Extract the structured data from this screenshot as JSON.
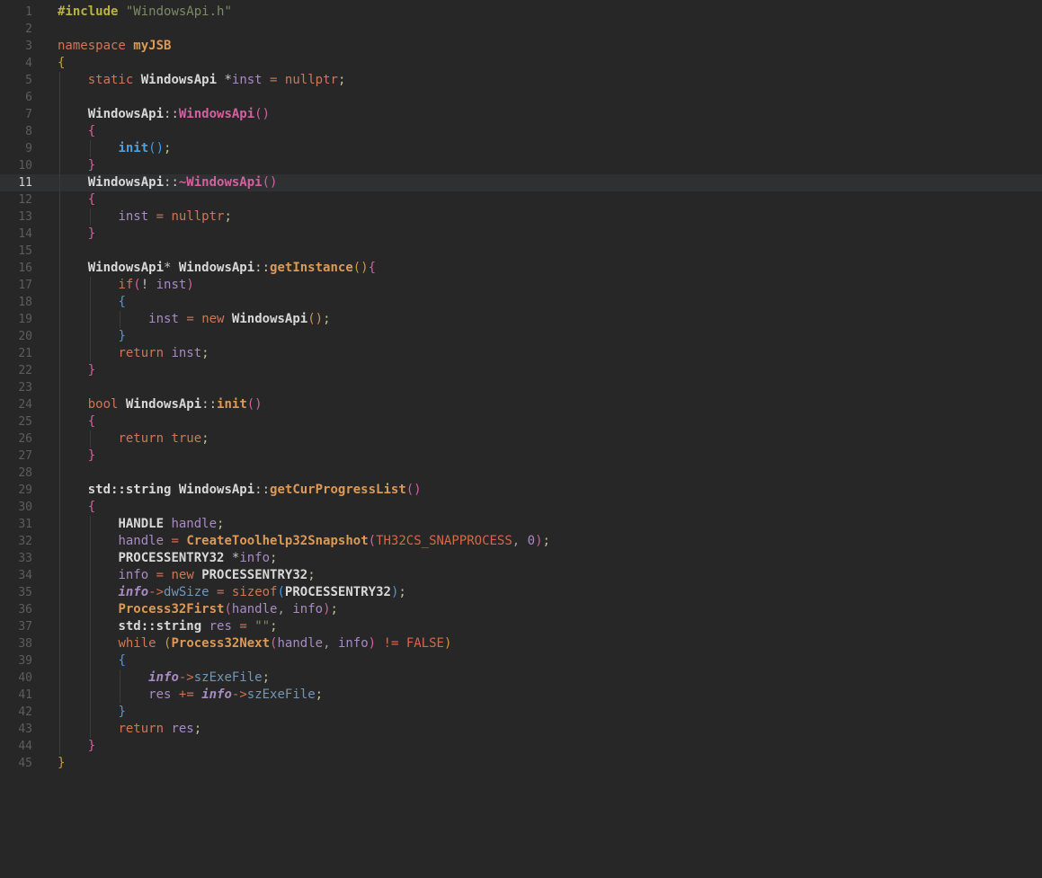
{
  "colors": {
    "bg": "#272727",
    "currentLineBg": "#2f3032",
    "lineNum": "#5d5d5d",
    "lineNumActive": "#d0d0d0",
    "guide": "#3b3b3b",
    "pre": "#b9b340",
    "kw": "#cd7757",
    "const": "#d5674a",
    "type": "#d8d8d8",
    "fn": "#dd9956",
    "ctor": "#d3609f",
    "call": "#4fa0dd",
    "var": "#a98bc4",
    "field": "#7396b8",
    "str": "#7d8b64",
    "semi": "#bfc291",
    "comma": "#a09aaa",
    "op": "#cd7054",
    "plain": "#c5c5c5",
    "b1": "#c9983f",
    "b2": "#d3609f",
    "b3": "#4499e8"
  },
  "editor": {
    "current_line": 11,
    "lines": [
      {
        "n": 1,
        "guides": [],
        "tokens": [
          [
            "pre",
            "#include"
          ],
          [
            "plain",
            " "
          ],
          [
            "str",
            "\"WindowsApi.h\""
          ]
        ]
      },
      {
        "n": 2,
        "guides": [],
        "tokens": []
      },
      {
        "n": 3,
        "guides": [],
        "tokens": [
          [
            "kw",
            "namespace"
          ],
          [
            "plain",
            " "
          ],
          [
            "fn",
            "myJSB"
          ]
        ]
      },
      {
        "n": 4,
        "guides": [],
        "tokens": [
          [
            "b1",
            "{"
          ]
        ]
      },
      {
        "n": 5,
        "guides": [
          0
        ],
        "tokens": [
          [
            "plain",
            "    "
          ],
          [
            "kw",
            "static"
          ],
          [
            "plain",
            " "
          ],
          [
            "type",
            "WindowsApi"
          ],
          [
            "plain",
            " *"
          ],
          [
            "var",
            "inst"
          ],
          [
            "plain",
            " "
          ],
          [
            "op",
            "="
          ],
          [
            "plain",
            " "
          ],
          [
            "kw",
            "nullptr"
          ],
          [
            "semi",
            ";"
          ]
        ]
      },
      {
        "n": 6,
        "guides": [
          0
        ],
        "tokens": []
      },
      {
        "n": 7,
        "guides": [
          0
        ],
        "tokens": [
          [
            "plain",
            "    "
          ],
          [
            "type",
            "WindowsApi"
          ],
          [
            "plain",
            "::"
          ],
          [
            "ctor",
            "WindowsApi"
          ],
          [
            "b2",
            "()"
          ]
        ]
      },
      {
        "n": 8,
        "guides": [
          0
        ],
        "tokens": [
          [
            "plain",
            "    "
          ],
          [
            "b2",
            "{"
          ]
        ]
      },
      {
        "n": 9,
        "guides": [
          0,
          4
        ],
        "tokens": [
          [
            "plain",
            "        "
          ],
          [
            "call",
            "init"
          ],
          [
            "b3",
            "()"
          ],
          [
            "semi",
            ";"
          ]
        ]
      },
      {
        "n": 10,
        "guides": [
          0
        ],
        "tokens": [
          [
            "plain",
            "    "
          ],
          [
            "b2",
            "}"
          ]
        ]
      },
      {
        "n": 11,
        "guides": [
          0
        ],
        "tokens": [
          [
            "plain",
            "    "
          ],
          [
            "type",
            "WindowsApi"
          ],
          [
            "plain",
            "::"
          ],
          [
            "ctor",
            "~WindowsApi"
          ],
          [
            "b2",
            "()"
          ]
        ]
      },
      {
        "n": 12,
        "guides": [
          0
        ],
        "tokens": [
          [
            "plain",
            "    "
          ],
          [
            "b2",
            "{"
          ]
        ]
      },
      {
        "n": 13,
        "guides": [
          0,
          4
        ],
        "tokens": [
          [
            "plain",
            "        "
          ],
          [
            "var",
            "inst"
          ],
          [
            "plain",
            " "
          ],
          [
            "op",
            "="
          ],
          [
            "plain",
            " "
          ],
          [
            "kw",
            "nullptr"
          ],
          [
            "semi",
            ";"
          ]
        ]
      },
      {
        "n": 14,
        "guides": [
          0
        ],
        "tokens": [
          [
            "plain",
            "    "
          ],
          [
            "b2",
            "}"
          ]
        ]
      },
      {
        "n": 15,
        "guides": [
          0
        ],
        "tokens": []
      },
      {
        "n": 16,
        "guides": [
          0
        ],
        "tokens": [
          [
            "plain",
            "    "
          ],
          [
            "type",
            "WindowsApi"
          ],
          [
            "plain",
            "* "
          ],
          [
            "type",
            "WindowsApi"
          ],
          [
            "plain",
            "::"
          ],
          [
            "fn",
            "getInstance"
          ],
          [
            "b1",
            "()"
          ],
          [
            "b2",
            "{"
          ]
        ]
      },
      {
        "n": 17,
        "guides": [
          0,
          4
        ],
        "tokens": [
          [
            "plain",
            "        "
          ],
          [
            "kw",
            "if"
          ],
          [
            "b2",
            "("
          ],
          [
            "plain",
            "! "
          ],
          [
            "var",
            "inst"
          ],
          [
            "b2",
            ")"
          ]
        ]
      },
      {
        "n": 18,
        "guides": [
          0,
          4
        ],
        "tokens": [
          [
            "plain",
            "        "
          ],
          [
            "b3",
            "{"
          ]
        ]
      },
      {
        "n": 19,
        "guides": [
          0,
          4,
          8
        ],
        "tokens": [
          [
            "plain",
            "            "
          ],
          [
            "var",
            "inst"
          ],
          [
            "plain",
            " "
          ],
          [
            "op",
            "="
          ],
          [
            "plain",
            " "
          ],
          [
            "kw",
            "new"
          ],
          [
            "plain",
            " "
          ],
          [
            "type",
            "WindowsApi"
          ],
          [
            "b1",
            "()"
          ],
          [
            "semi",
            ";"
          ]
        ]
      },
      {
        "n": 20,
        "guides": [
          0,
          4
        ],
        "tokens": [
          [
            "plain",
            "        "
          ],
          [
            "b3",
            "}"
          ]
        ]
      },
      {
        "n": 21,
        "guides": [
          0,
          4
        ],
        "tokens": [
          [
            "plain",
            "        "
          ],
          [
            "kw",
            "return"
          ],
          [
            "plain",
            " "
          ],
          [
            "var",
            "inst"
          ],
          [
            "semi",
            ";"
          ]
        ]
      },
      {
        "n": 22,
        "guides": [
          0
        ],
        "tokens": [
          [
            "plain",
            "    "
          ],
          [
            "b2",
            "}"
          ]
        ]
      },
      {
        "n": 23,
        "guides": [
          0
        ],
        "tokens": []
      },
      {
        "n": 24,
        "guides": [
          0
        ],
        "tokens": [
          [
            "plain",
            "    "
          ],
          [
            "kw",
            "bool"
          ],
          [
            "plain",
            " "
          ],
          [
            "type",
            "WindowsApi"
          ],
          [
            "plain",
            "::"
          ],
          [
            "fn",
            "init"
          ],
          [
            "b2",
            "()"
          ]
        ]
      },
      {
        "n": 25,
        "guides": [
          0
        ],
        "tokens": [
          [
            "plain",
            "    "
          ],
          [
            "b2",
            "{"
          ]
        ]
      },
      {
        "n": 26,
        "guides": [
          0,
          4
        ],
        "tokens": [
          [
            "plain",
            "        "
          ],
          [
            "kw",
            "return"
          ],
          [
            "plain",
            " "
          ],
          [
            "kw",
            "true"
          ],
          [
            "semi",
            ";"
          ]
        ]
      },
      {
        "n": 27,
        "guides": [
          0
        ],
        "tokens": [
          [
            "plain",
            "    "
          ],
          [
            "b2",
            "}"
          ]
        ]
      },
      {
        "n": 28,
        "guides": [
          0
        ],
        "tokens": []
      },
      {
        "n": 29,
        "guides": [
          0
        ],
        "tokens": [
          [
            "plain",
            "    "
          ],
          [
            "type",
            "std::string"
          ],
          [
            "plain",
            " "
          ],
          [
            "type",
            "WindowsApi"
          ],
          [
            "plain",
            "::"
          ],
          [
            "fn",
            "getCurProgressList"
          ],
          [
            "b2",
            "()"
          ]
        ]
      },
      {
        "n": 30,
        "guides": [
          0
        ],
        "tokens": [
          [
            "plain",
            "    "
          ],
          [
            "b2",
            "{"
          ]
        ]
      },
      {
        "n": 31,
        "guides": [
          0,
          4
        ],
        "tokens": [
          [
            "plain",
            "        "
          ],
          [
            "type",
            "HANDLE"
          ],
          [
            "plain",
            " "
          ],
          [
            "var",
            "handle"
          ],
          [
            "semi",
            ";"
          ]
        ]
      },
      {
        "n": 32,
        "guides": [
          0,
          4
        ],
        "tokens": [
          [
            "plain",
            "        "
          ],
          [
            "var",
            "handle"
          ],
          [
            "plain",
            " "
          ],
          [
            "op",
            "="
          ],
          [
            "plain",
            " "
          ],
          [
            "fn",
            "CreateToolhelp32Snapshot"
          ],
          [
            "b2",
            "("
          ],
          [
            "const",
            "TH32CS_SNAPPROCESS"
          ],
          [
            "comma",
            ","
          ],
          [
            "plain",
            " "
          ],
          [
            "num",
            "0"
          ],
          [
            "b2",
            ")"
          ],
          [
            "semi",
            ";"
          ]
        ]
      },
      {
        "n": 33,
        "guides": [
          0,
          4
        ],
        "tokens": [
          [
            "plain",
            "        "
          ],
          [
            "type",
            "PROCESSENTRY32"
          ],
          [
            "plain",
            " *"
          ],
          [
            "var",
            "info"
          ],
          [
            "semi",
            ";"
          ]
        ]
      },
      {
        "n": 34,
        "guides": [
          0,
          4
        ],
        "tokens": [
          [
            "plain",
            "        "
          ],
          [
            "var",
            "info"
          ],
          [
            "plain",
            " "
          ],
          [
            "op",
            "="
          ],
          [
            "plain",
            " "
          ],
          [
            "kw",
            "new"
          ],
          [
            "plain",
            " "
          ],
          [
            "type",
            "PROCESSENTRY32"
          ],
          [
            "semi",
            ";"
          ]
        ]
      },
      {
        "n": 35,
        "guides": [
          0,
          4
        ],
        "tokens": [
          [
            "plain",
            "        "
          ],
          [
            "varbi",
            "info"
          ],
          [
            "op",
            "->"
          ],
          [
            "field",
            "dwSize"
          ],
          [
            "plain",
            " "
          ],
          [
            "op",
            "="
          ],
          [
            "plain",
            " "
          ],
          [
            "kw",
            "sizeof"
          ],
          [
            "b3",
            "("
          ],
          [
            "type",
            "PROCESSENTRY32"
          ],
          [
            "b3",
            ")"
          ],
          [
            "semi",
            ";"
          ]
        ]
      },
      {
        "n": 36,
        "guides": [
          0,
          4
        ],
        "tokens": [
          [
            "plain",
            "        "
          ],
          [
            "fn",
            "Process32First"
          ],
          [
            "b2",
            "("
          ],
          [
            "var",
            "handle"
          ],
          [
            "comma",
            ","
          ],
          [
            "plain",
            " "
          ],
          [
            "var",
            "info"
          ],
          [
            "b2",
            ")"
          ],
          [
            "semi",
            ";"
          ]
        ]
      },
      {
        "n": 37,
        "guides": [
          0,
          4
        ],
        "tokens": [
          [
            "plain",
            "        "
          ],
          [
            "type",
            "std::string"
          ],
          [
            "plain",
            " "
          ],
          [
            "var",
            "res"
          ],
          [
            "plain",
            " "
          ],
          [
            "op",
            "="
          ],
          [
            "plain",
            " "
          ],
          [
            "str",
            "\"\""
          ],
          [
            "semi",
            ";"
          ]
        ]
      },
      {
        "n": 38,
        "guides": [
          0,
          4
        ],
        "tokens": [
          [
            "plain",
            "        "
          ],
          [
            "kw",
            "while"
          ],
          [
            "plain",
            " "
          ],
          [
            "b1",
            "("
          ],
          [
            "fn",
            "Process32Next"
          ],
          [
            "b2",
            "("
          ],
          [
            "var",
            "handle"
          ],
          [
            "comma",
            ","
          ],
          [
            "plain",
            " "
          ],
          [
            "var",
            "info"
          ],
          [
            "b2",
            ")"
          ],
          [
            "plain",
            " "
          ],
          [
            "op",
            "!="
          ],
          [
            "plain",
            " "
          ],
          [
            "const",
            "FALSE"
          ],
          [
            "b1",
            ")"
          ]
        ]
      },
      {
        "n": 39,
        "guides": [
          0,
          4
        ],
        "tokens": [
          [
            "plain",
            "        "
          ],
          [
            "b3",
            "{"
          ]
        ]
      },
      {
        "n": 40,
        "guides": [
          0,
          4,
          8
        ],
        "tokens": [
          [
            "plain",
            "            "
          ],
          [
            "varbi",
            "info"
          ],
          [
            "op",
            "->"
          ],
          [
            "field",
            "szExeFile"
          ],
          [
            "semi",
            ";"
          ]
        ]
      },
      {
        "n": 41,
        "guides": [
          0,
          4,
          8
        ],
        "tokens": [
          [
            "plain",
            "            "
          ],
          [
            "var",
            "res"
          ],
          [
            "plain",
            " "
          ],
          [
            "op",
            "+="
          ],
          [
            "plain",
            " "
          ],
          [
            "varbi",
            "info"
          ],
          [
            "op",
            "->"
          ],
          [
            "field",
            "szExeFile"
          ],
          [
            "semi",
            ";"
          ]
        ]
      },
      {
        "n": 42,
        "guides": [
          0,
          4
        ],
        "tokens": [
          [
            "plain",
            "        "
          ],
          [
            "b3",
            "}"
          ]
        ]
      },
      {
        "n": 43,
        "guides": [
          0,
          4
        ],
        "tokens": [
          [
            "plain",
            "        "
          ],
          [
            "kw",
            "return"
          ],
          [
            "plain",
            " "
          ],
          [
            "var",
            "res"
          ],
          [
            "semi",
            ";"
          ]
        ]
      },
      {
        "n": 44,
        "guides": [
          0
        ],
        "tokens": [
          [
            "plain",
            "    "
          ],
          [
            "b2",
            "}"
          ]
        ]
      },
      {
        "n": 45,
        "guides": [],
        "tokens": [
          [
            "b1",
            "}"
          ]
        ]
      }
    ]
  }
}
